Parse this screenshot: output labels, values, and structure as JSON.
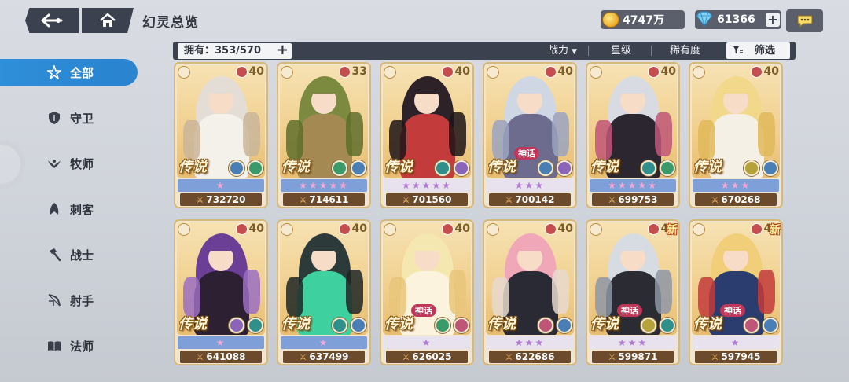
{
  "header": {
    "title": "幻灵总览",
    "gold": "4747万",
    "gems": "61366"
  },
  "toolbar": {
    "owned": "拥有：353/570",
    "sort_power": "战力",
    "sort_star": "星级",
    "sort_rarity": "稀有度",
    "filter": "筛选"
  },
  "sidebar": {
    "items": [
      {
        "label": "全部",
        "icon": "all-star-icon",
        "active": true
      },
      {
        "label": "守卫",
        "icon": "shield-icon",
        "active": false
      },
      {
        "label": "牧师",
        "icon": "wings-icon",
        "active": false
      },
      {
        "label": "刺客",
        "icon": "dagger-icon",
        "active": false
      },
      {
        "label": "战士",
        "icon": "hammer-icon",
        "active": false
      },
      {
        "label": "射手",
        "icon": "bow-icon",
        "active": false
      },
      {
        "label": "法师",
        "icon": "book-icon",
        "active": false
      }
    ]
  },
  "cards": [
    {
      "level": "40",
      "rarity": "传说",
      "myth": "",
      "stars": "★",
      "star_style": "blue",
      "power": "732720",
      "new": "",
      "elements": [
        "#4a7fb5",
        "#3b9a6a"
      ],
      "palette": [
        "#e3ddd6",
        "#f4f0ea",
        "#c9b59a"
      ]
    },
    {
      "level": "33",
      "rarity": "传说",
      "myth": "",
      "stars": "★★★★★",
      "star_style": "blue",
      "power": "714611",
      "new": "",
      "elements": [
        "#3b9a6a",
        "#4a7fb5"
      ],
      "palette": [
        "#7b8a3e",
        "#a48a52",
        "#5f6e2c"
      ]
    },
    {
      "level": "40",
      "rarity": "传说",
      "myth": "",
      "stars": "★★★★★",
      "star_style": "pale",
      "power": "701560",
      "new": "",
      "elements": [
        "#2f8f8a",
        "#8a64b8"
      ],
      "palette": [
        "#2c2228",
        "#c33b3b",
        "#1c1418"
      ]
    },
    {
      "level": "40",
      "rarity": "传说",
      "myth": "神话",
      "stars": "★★★",
      "star_style": "pale",
      "power": "700142",
      "new": "",
      "elements": [
        "#4a7fb5",
        "#8a64b8"
      ],
      "palette": [
        "#cfd6e4",
        "#6d6c8e",
        "#9aa3c0"
      ]
    },
    {
      "level": "40",
      "rarity": "传说",
      "myth": "",
      "stars": "★★★★★",
      "star_style": "blue",
      "power": "699753",
      "new": "",
      "elements": [
        "#2f8f8a",
        "#3b9a6a"
      ],
      "palette": [
        "#d9dbe3",
        "#2b2630",
        "#c05677"
      ]
    },
    {
      "level": "40",
      "rarity": "传说",
      "myth": "",
      "stars": "★★★",
      "star_style": "blue",
      "power": "670268",
      "new": "",
      "elements": [
        "#b5a23a",
        "#4a7fb5"
      ],
      "palette": [
        "#f1d88a",
        "#f5f0e6",
        "#e0b85a"
      ]
    },
    {
      "level": "40",
      "rarity": "传说",
      "myth": "",
      "stars": "★",
      "star_style": "blue",
      "power": "641088",
      "new": "",
      "elements": [
        "#8a64b8",
        "#2f8f8a"
      ],
      "palette": [
        "#6a3f95",
        "#2c2032",
        "#9b6fc2"
      ]
    },
    {
      "level": "40",
      "rarity": "传说",
      "myth": "",
      "stars": "★",
      "star_style": "blue",
      "power": "637499",
      "new": "",
      "elements": [
        "#2f8f8a",
        "#4a7fb5"
      ],
      "palette": [
        "#2c3b3a",
        "#3fd0a0",
        "#1d2626"
      ]
    },
    {
      "level": "40",
      "rarity": "传说",
      "myth": "神话",
      "stars": "★",
      "star_style": "pale",
      "power": "626025",
      "new": "",
      "elements": [
        "#3b9a6a",
        "#c05677"
      ],
      "palette": [
        "#f5e7b0",
        "#fbf3de",
        "#e7c67a"
      ]
    },
    {
      "level": "40",
      "rarity": "传说",
      "myth": "",
      "stars": "★★★",
      "star_style": "pale",
      "power": "622686",
      "new": "",
      "elements": [
        "#c05677",
        "#4a7fb5"
      ],
      "palette": [
        "#f0a8b8",
        "#2a2a35",
        "#e6d9ce"
      ]
    },
    {
      "level": "40",
      "rarity": "传说",
      "myth": "神话",
      "stars": "★★★",
      "star_style": "pale",
      "power": "599871",
      "new": "新",
      "elements": [
        "#b5a23a",
        "#2f8f8a"
      ],
      "palette": [
        "#d7dbe2",
        "#2a2b33",
        "#8e96a5"
      ]
    },
    {
      "level": "40",
      "rarity": "传说",
      "myth": "神话",
      "stars": "★",
      "star_style": "pale",
      "power": "597945",
      "new": "新",
      "elements": [
        "#c05677",
        "#4a7fb5"
      ],
      "palette": [
        "#f1cf7a",
        "#2a3d6e",
        "#c23b3b"
      ]
    }
  ]
}
